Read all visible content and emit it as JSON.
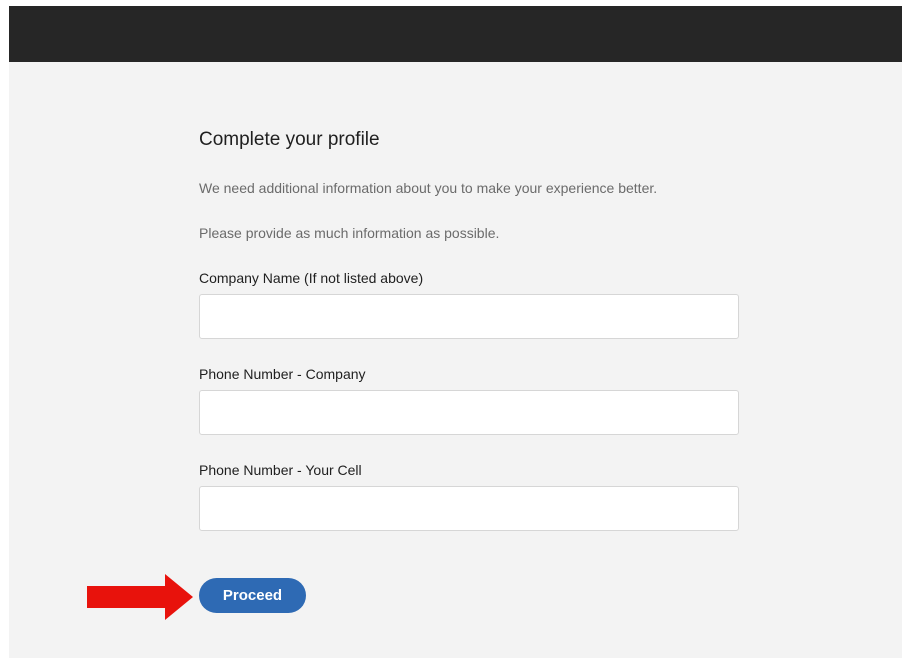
{
  "header": {
    "color": "#262626"
  },
  "profile_form": {
    "title": "Complete your profile",
    "description_1": "We need additional information about you to make your experience better.",
    "description_2": "Please provide as much information as possible.",
    "fields": [
      {
        "label": "Company Name (If not listed above)",
        "value": "",
        "placeholder": ""
      },
      {
        "label": "Phone Number - Company",
        "value": "",
        "placeholder": ""
      },
      {
        "label": "Phone Number - Your Cell",
        "value": "",
        "placeholder": ""
      }
    ],
    "proceed_label": "Proceed",
    "proceed_color": "#2e6ab4"
  },
  "annotation": {
    "icon": "red-arrow-right-icon",
    "color": "#e8120c"
  }
}
